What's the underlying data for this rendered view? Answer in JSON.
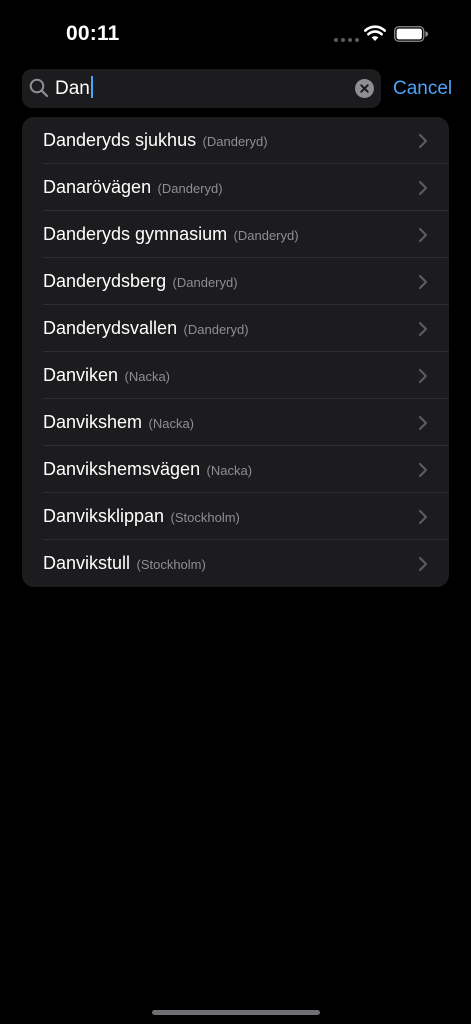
{
  "status_bar": {
    "time": "00:11"
  },
  "search": {
    "query": "Dan",
    "cancel_label": "Cancel"
  },
  "results": [
    {
      "name": "Danderyds sjukhus",
      "area": "(Danderyd)"
    },
    {
      "name": "Danarövägen",
      "area": "(Danderyd)"
    },
    {
      "name": "Danderyds gymnasium",
      "area": "(Danderyd)"
    },
    {
      "name": "Danderydsberg",
      "area": "(Danderyd)"
    },
    {
      "name": "Danderydsvallen",
      "area": "(Danderyd)"
    },
    {
      "name": "Danviken",
      "area": "(Nacka)"
    },
    {
      "name": "Danvikshem",
      "area": "(Nacka)"
    },
    {
      "name": "Danvikshemsvägen",
      "area": "(Nacka)"
    },
    {
      "name": "Danviksklippan",
      "area": "(Stockholm)"
    },
    {
      "name": "Danvikstull",
      "area": "(Stockholm)"
    }
  ],
  "icons": {
    "search": "search-icon",
    "clear": "clear-icon",
    "chevron": "chevron-right-icon",
    "wifi": "wifi-icon",
    "battery": "battery-icon"
  },
  "colors": {
    "background": "#000000",
    "surface": "#1c1c1e",
    "accent": "#4da3f7",
    "secondary_text": "#8e8e93"
  }
}
